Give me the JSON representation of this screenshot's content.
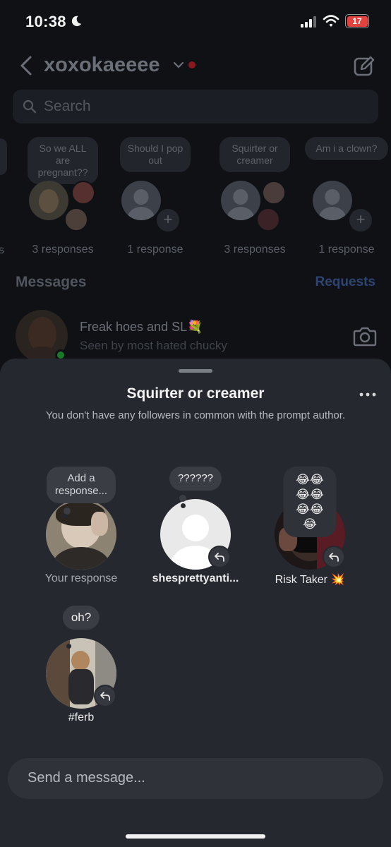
{
  "status_bar": {
    "time": "10:38",
    "battery": "17"
  },
  "header": {
    "account_name": "xoxokaeeee"
  },
  "search": {
    "placeholder": "Search"
  },
  "prompts": [
    {
      "text": "So we ALL are pregnant??",
      "count": "3 responses"
    },
    {
      "text": "Should I pop out",
      "count": "1 response"
    },
    {
      "text": "Squirter or creamer",
      "count": "3 responses"
    },
    {
      "text": "Am i a clown?",
      "count": "1 response"
    }
  ],
  "messages": {
    "heading": "Messages",
    "requests_label": "Requests",
    "chat": {
      "title": "Freak hoes and SL💐",
      "subtitle": "Seen by most hated chucky"
    }
  },
  "sheet": {
    "title": "Squirter or creamer",
    "subtitle": "You don't have any followers in common with the prompt author.",
    "responses": [
      {
        "bubble": "Add a\nresponse...",
        "name": "Your response"
      },
      {
        "bubble": "??????",
        "name": "shesprettyanti..."
      },
      {
        "bubble": "😂😂😂😂\n😂😂😂",
        "name": "Risk Taker 💥"
      },
      {
        "bubble": "oh?",
        "name": "#ferb"
      }
    ],
    "message_placeholder": "Send a message..."
  },
  "colors": {
    "sheet_bg": "#25282e",
    "bubble_bg": "#3a3d44",
    "accent_link": "#2e4472",
    "notif_dot": "#8a1620"
  }
}
